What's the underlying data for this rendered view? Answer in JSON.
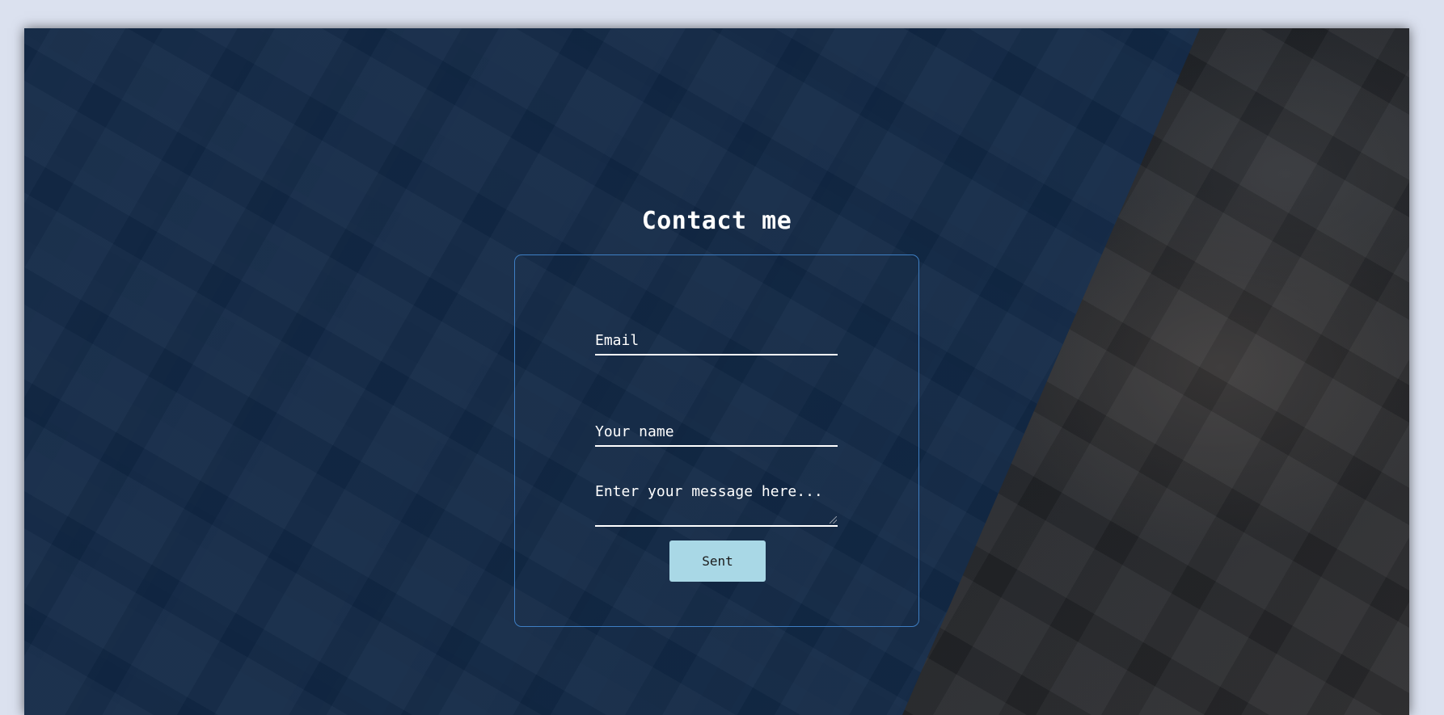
{
  "page": {
    "heading": "Contact me"
  },
  "form": {
    "email_placeholder": "Email",
    "name_placeholder": "Your name",
    "message_placeholder": "Enter your message here...",
    "submit_label": "Sent"
  },
  "colors": {
    "page_background": "#dbe1ef",
    "overlay": "#10284a",
    "form_border": "#3e7fc4",
    "button": "#a9d8e6",
    "text": "#ffffff"
  }
}
